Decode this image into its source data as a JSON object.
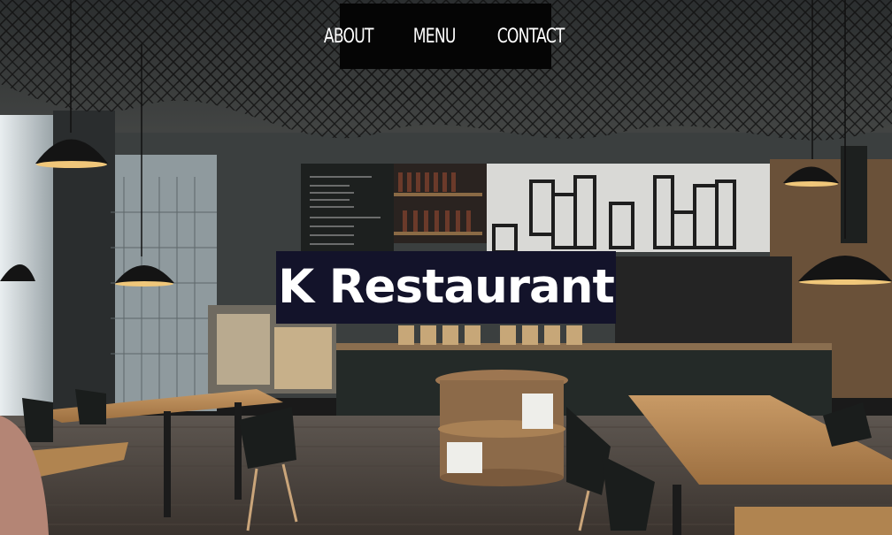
{
  "nav": {
    "items": [
      {
        "label": "ABOUT"
      },
      {
        "label": "MENU"
      },
      {
        "label": "CONTACT"
      }
    ]
  },
  "hero": {
    "title": "K Restaurant",
    "background_image": "restaurant-interior-photo"
  },
  "colors": {
    "nav_background": "#050505",
    "nav_text": "#ffffff",
    "title_background": "#13132a",
    "title_text": "#ffffff"
  }
}
